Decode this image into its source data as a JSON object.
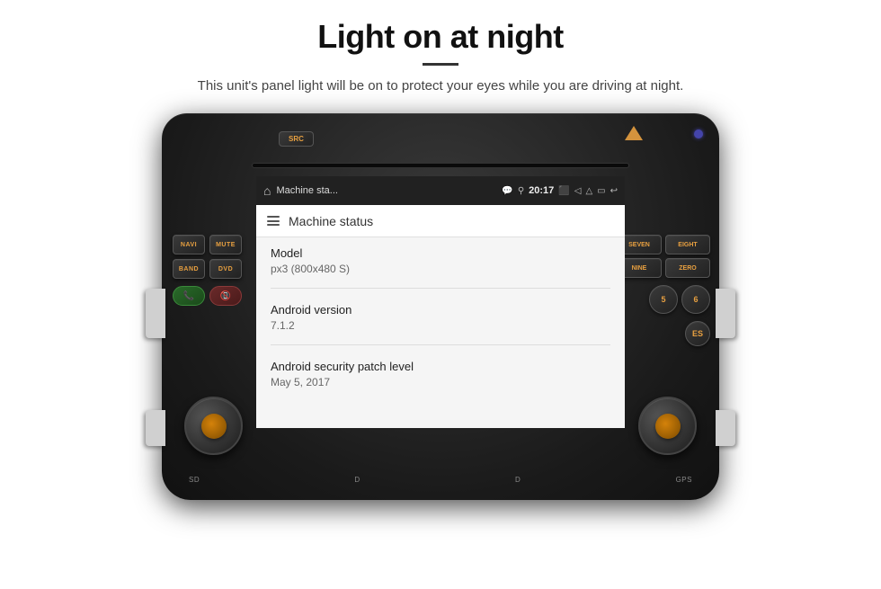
{
  "page": {
    "title": "Light on at night",
    "divider": true,
    "subtitle": "This unit's panel light will be on to protect your eyes while you are driving at night."
  },
  "screen": {
    "status_bar": {
      "app_name": "Machine sta...",
      "time": "20:17"
    },
    "header": {
      "title": "Machine status"
    },
    "items": [
      {
        "label": "Model",
        "value": "px3 (800x480 S)"
      },
      {
        "label": "Android version",
        "value": "7.1.2"
      },
      {
        "label": "Android security patch level",
        "value": "May 5, 2017"
      }
    ]
  },
  "controls": {
    "left_buttons": [
      "NAVI",
      "MUTE",
      "BAND",
      "DVD",
      "SRC"
    ],
    "right_buttons": [
      "SEVEN",
      "EIGHT",
      "NINE",
      "ZERO"
    ],
    "bottom_labels": [
      "SD",
      "D",
      "D",
      "GPS"
    ]
  }
}
